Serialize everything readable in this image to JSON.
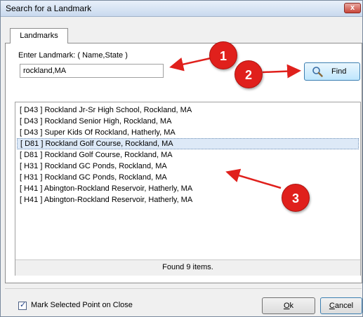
{
  "window": {
    "title": "Search for a Landmark",
    "close_glyph": "x"
  },
  "tabs": [
    {
      "label": "Landmarks",
      "active": true
    }
  ],
  "search": {
    "label": "Enter Landmark: ( Name,State )",
    "value": "rockland,MA",
    "find_label": "Find",
    "find_icon": "magnifier-icon"
  },
  "results": {
    "items": [
      "[ D43 ] Rockland Jr-Sr High School, Rockland, MA",
      "[ D43 ] Rockland Senior High, Rockland, MA",
      "[ D43 ] Super Kids Of Rockland, Hatherly, MA",
      "[ D81 ] Rockland Golf Course, Rockland, MA",
      "[ D81 ] Rockland Golf Course, Rockland, MA",
      "[ H31 ] Rockland GC Ponds, Rockland, MA",
      "[ H31 ] Rockland GC Ponds, Rockland, MA",
      "[ H41 ] Abington-Rockland Reservoir, Hatherly, MA",
      "[ H41 ] Abington-Rockland Reservoir, Hatherly, MA"
    ],
    "selected_index": 3,
    "status": "Found 9 items."
  },
  "footer": {
    "mark_label": "Mark Selected Point on Close",
    "mark_checked": true,
    "ok_access": "O",
    "ok_rest": "k",
    "cancel_access": "C",
    "cancel_rest": "ancel"
  },
  "callouts": [
    {
      "label": "1"
    },
    {
      "label": "2"
    },
    {
      "label": "3"
    }
  ],
  "colors": {
    "callout": "#e0201c",
    "selection": "#dde9f7",
    "accent": "#3c7fb1"
  }
}
